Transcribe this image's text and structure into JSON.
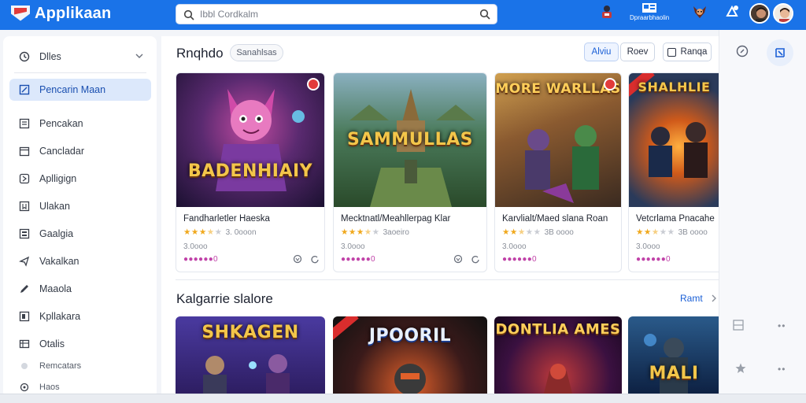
{
  "app": {
    "name": "Applikaan"
  },
  "search": {
    "placeholder": "Ibbl Cordkalm"
  },
  "topbar": {
    "items": [
      {
        "label": "",
        "icon": "joystick-icon"
      },
      {
        "label": "Dpraarbhaolin",
        "icon": "news-icon"
      },
      {
        "label": "",
        "icon": "game-character-icon"
      },
      {
        "label": "",
        "icon": "notification-icon"
      }
    ],
    "colors": {
      "bar": "#1a73e8"
    }
  },
  "sidebar": {
    "header": {
      "label": "Dlles",
      "icon": "clock-icon"
    },
    "items": [
      {
        "label": "Pencarin Maan",
        "icon": "edit-icon",
        "active": true
      },
      {
        "label": "Pencakan",
        "icon": "list-icon"
      },
      {
        "label": "Cancladar",
        "icon": "calendar-icon"
      },
      {
        "label": "Aplligign",
        "icon": "puzzle-icon"
      },
      {
        "label": "Ulakan",
        "icon": "bookmark-icon"
      },
      {
        "label": "Gaalgia",
        "icon": "grid-icon"
      },
      {
        "label": "Vakalkan",
        "icon": "share-icon"
      },
      {
        "label": "Maaola",
        "icon": "pencil-icon"
      },
      {
        "label": "Kpllakara",
        "icon": "document-icon"
      },
      {
        "label": "Otalis",
        "icon": "table-icon"
      },
      {
        "label": "Remcatars",
        "icon": "dot-icon"
      },
      {
        "label": "Haos",
        "icon": "circle-icon"
      }
    ]
  },
  "section1": {
    "title": "Rnqhdo",
    "pill": "Sanahlsas",
    "actions": [
      {
        "label": "Alviu",
        "style": "blue"
      },
      {
        "label": "Roev",
        "style": "plain"
      },
      {
        "label": "Ranqa",
        "style": "plain",
        "icon": "window-icon"
      }
    ]
  },
  "cards": [
    {
      "art_title": "BADENHIAIY",
      "name": "Fandharletler Haeska",
      "stars": 3.5,
      "reviews": "3. 0ooon",
      "sub": "3.0ooo",
      "price": "●●●●●●0",
      "bg": [
        "#2a1a4a",
        "#7a2a6a"
      ],
      "badge": true
    },
    {
      "art_title": "SAMMULLAS",
      "name": "Mecktnatl/Meahllerpag Klar",
      "stars": 3.5,
      "reviews": "3aoeiro",
      "sub": "3.0ooo",
      "price": "●●●●●●0",
      "bg": [
        "#3a6a4a",
        "#8aa56a"
      ],
      "badge": false
    },
    {
      "art_title": "MORE WARLLAS",
      "name": "Karvlialt/Maed slana Roan",
      "stars": 2.5,
      "reviews": "3B oooo",
      "sub": "3.0ooo",
      "price": "●●●●●●0",
      "bg": [
        "#4a3a2a",
        "#a87a3a"
      ],
      "badge": true
    },
    {
      "art_title": "SHALHLIE",
      "name": "Vetcrlama Pnacahe",
      "stars": 2.5,
      "reviews": "3B oooo",
      "sub": "3.0ooo",
      "price": "●●●●●●0",
      "bg": [
        "#1a2a4a",
        "#d86a1a"
      ],
      "badge": false
    }
  ],
  "section2": {
    "title": "Kalgarrie slalore",
    "link": "Ramt",
    "cards": [
      {
        "art_title": "SHKAGEN",
        "bg": [
          "#3a2a6a",
          "#7a5ad0"
        ]
      },
      {
        "art_title": "JPOORIL",
        "bg": [
          "#1a1a22",
          "#c24a1a"
        ]
      },
      {
        "art_title": "DONTLIA AMES",
        "bg": [
          "#2a1040",
          "#a02a4a"
        ]
      },
      {
        "art_title": "MALI",
        "bg": [
          "#0a2a4a",
          "#3a7ab0"
        ]
      }
    ]
  },
  "rail": {
    "icons": [
      "compass-icon",
      "chevron-icon",
      "layout-icon",
      "star-icon"
    ]
  }
}
